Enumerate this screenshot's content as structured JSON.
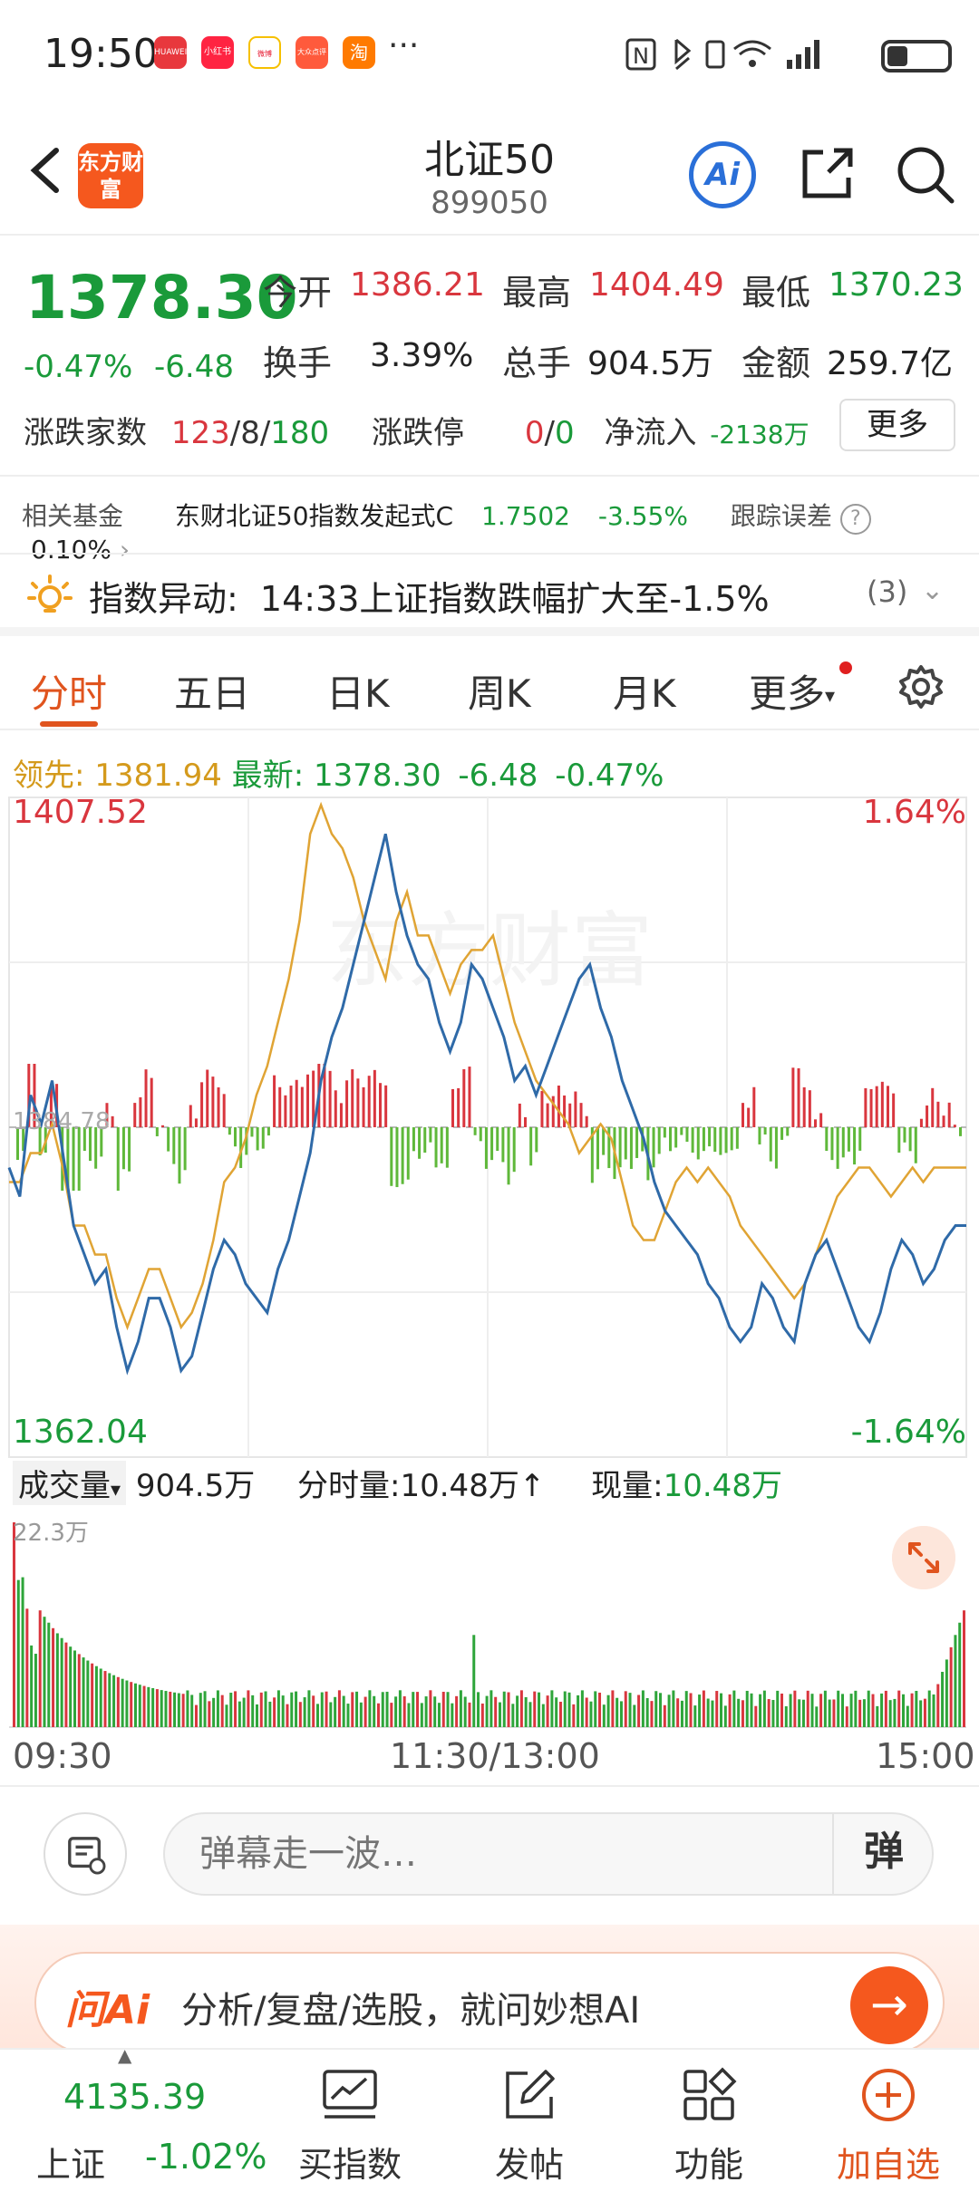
{
  "status_bar": {
    "time": "19:50",
    "apps": [
      "HUAWEI",
      "小红书",
      "微博",
      "大众点评",
      "淘"
    ],
    "more": "···"
  },
  "header": {
    "logo_text": "东方财富",
    "title": "北证50",
    "code": "899050"
  },
  "quote": {
    "price": "1378.30",
    "pct": "-0.47%",
    "change": "-6.48",
    "open_label": "今开",
    "open": "1386.21",
    "high_label": "最高",
    "high": "1404.49",
    "low_label": "最低",
    "low": "1370.23",
    "turnover_label": "换手",
    "turnover": "3.39%",
    "volume_label": "总手",
    "volume": "904.5万",
    "amount_label": "金额",
    "amount": "259.7亿",
    "breadth_label": "涨跌家数",
    "breadth_up": "123",
    "breadth_flat": "8",
    "breadth_down": "180",
    "limit_label": "涨跌停",
    "limit_up": "0",
    "limit_down": "0",
    "netflow_label": "净流入",
    "netflow": "-2138万",
    "more_label": "更多"
  },
  "fund": {
    "label": "相关基金",
    "name": "东财北证50指数发起式C",
    "nav": "1.7502",
    "pct": "-3.55%",
    "tracking_label": "跟踪误差",
    "tracking": "0.10%"
  },
  "alert": {
    "label": "指数异动:",
    "text": "14:33上证指数跌幅扩大至-1.5%",
    "count": "(3)"
  },
  "tabs": [
    "分时",
    "五日",
    "日K",
    "周K",
    "月K",
    "更多"
  ],
  "chart_info": {
    "leader_label": "领先:",
    "leader": "1381.94",
    "latest_label": "最新:",
    "latest": "1378.30",
    "change": "-6.48",
    "pct": "-0.47%"
  },
  "chart_labels": {
    "top": "1407.52",
    "bottom": "1362.04",
    "top_pct": "1.64%",
    "bottom_pct": "-1.64%",
    "baseline": "1384.78",
    "watermark": "东方财富"
  },
  "volume": {
    "select_label": "成交量",
    "total": "904.5万",
    "minute_label": "分时量:",
    "minute": "10.48万",
    "arrow": "↑",
    "current_label": "现量:",
    "current": "10.48万",
    "max": "22.3万"
  },
  "time_axis": [
    "09:30",
    "11:30/13:00",
    "15:00"
  ],
  "barrage": {
    "placeholder": "弹幕走一波…",
    "send": "弹"
  },
  "ai_bar": {
    "brand": "问Ai",
    "prompt": "分析/复盘/选股，就问妙想AI",
    "arrow": "→"
  },
  "bottom_nav": {
    "index_value": "4135.39",
    "index_name": "上证",
    "index_pct": "-1.02%",
    "items": [
      "买指数",
      "发帖",
      "功能",
      "加自选"
    ]
  },
  "chart_data": {
    "type": "line",
    "ylim": [
      1362.04,
      1407.52
    ],
    "baseline": 1384.78,
    "series": [
      {
        "name": "最新",
        "values": [
          1382,
          1380,
          1387,
          1385,
          1388,
          1383,
          1378,
          1376,
          1374,
          1375,
          1371,
          1368,
          1370,
          1373,
          1373,
          1371,
          1368,
          1369,
          1372,
          1375,
          1377,
          1376,
          1374,
          1373,
          1372,
          1375,
          1377,
          1380,
          1383,
          1388,
          1391,
          1393,
          1396,
          1399,
          1402,
          1405,
          1401,
          1398,
          1396,
          1395,
          1392,
          1390,
          1392,
          1396,
          1395,
          1393,
          1391,
          1388,
          1389,
          1387,
          1389,
          1391,
          1393,
          1395,
          1396,
          1393,
          1391,
          1388,
          1386,
          1384,
          1381,
          1379,
          1378,
          1377,
          1376,
          1374,
          1373,
          1371,
          1370,
          1371,
          1374,
          1373,
          1371,
          1370,
          1374,
          1376,
          1377,
          1375,
          1373,
          1371,
          1370,
          1372,
          1375,
          1377,
          1376,
          1374,
          1375,
          1377,
          1378,
          1378
        ]
      },
      {
        "name": "领先",
        "values": [
          1381,
          1381,
          1383,
          1383,
          1385,
          1382,
          1378,
          1378,
          1376,
          1376,
          1373,
          1371,
          1373,
          1375,
          1375,
          1373,
          1371,
          1372,
          1374,
          1377,
          1381,
          1382,
          1384,
          1387,
          1389,
          1392,
          1395,
          1399,
          1405,
          1407,
          1405,
          1404,
          1402,
          1399,
          1397,
          1395,
          1399,
          1401,
          1398,
          1398,
          1396,
          1394,
          1396,
          1397,
          1397,
          1398,
          1395,
          1392,
          1390,
          1388,
          1387,
          1386,
          1385,
          1383,
          1384,
          1385,
          1384,
          1381,
          1378,
          1377,
          1377,
          1379,
          1381,
          1382,
          1381,
          1382,
          1381,
          1380,
          1378,
          1377,
          1376,
          1375,
          1374,
          1373,
          1374,
          1376,
          1378,
          1380,
          1381,
          1382,
          1382,
          1381,
          1380,
          1381,
          1382,
          1381,
          1382,
          1382,
          1382,
          1382
        ]
      }
    ],
    "volume_ylim": [
      0,
      22.3
    ],
    "volume_unit": "万"
  }
}
